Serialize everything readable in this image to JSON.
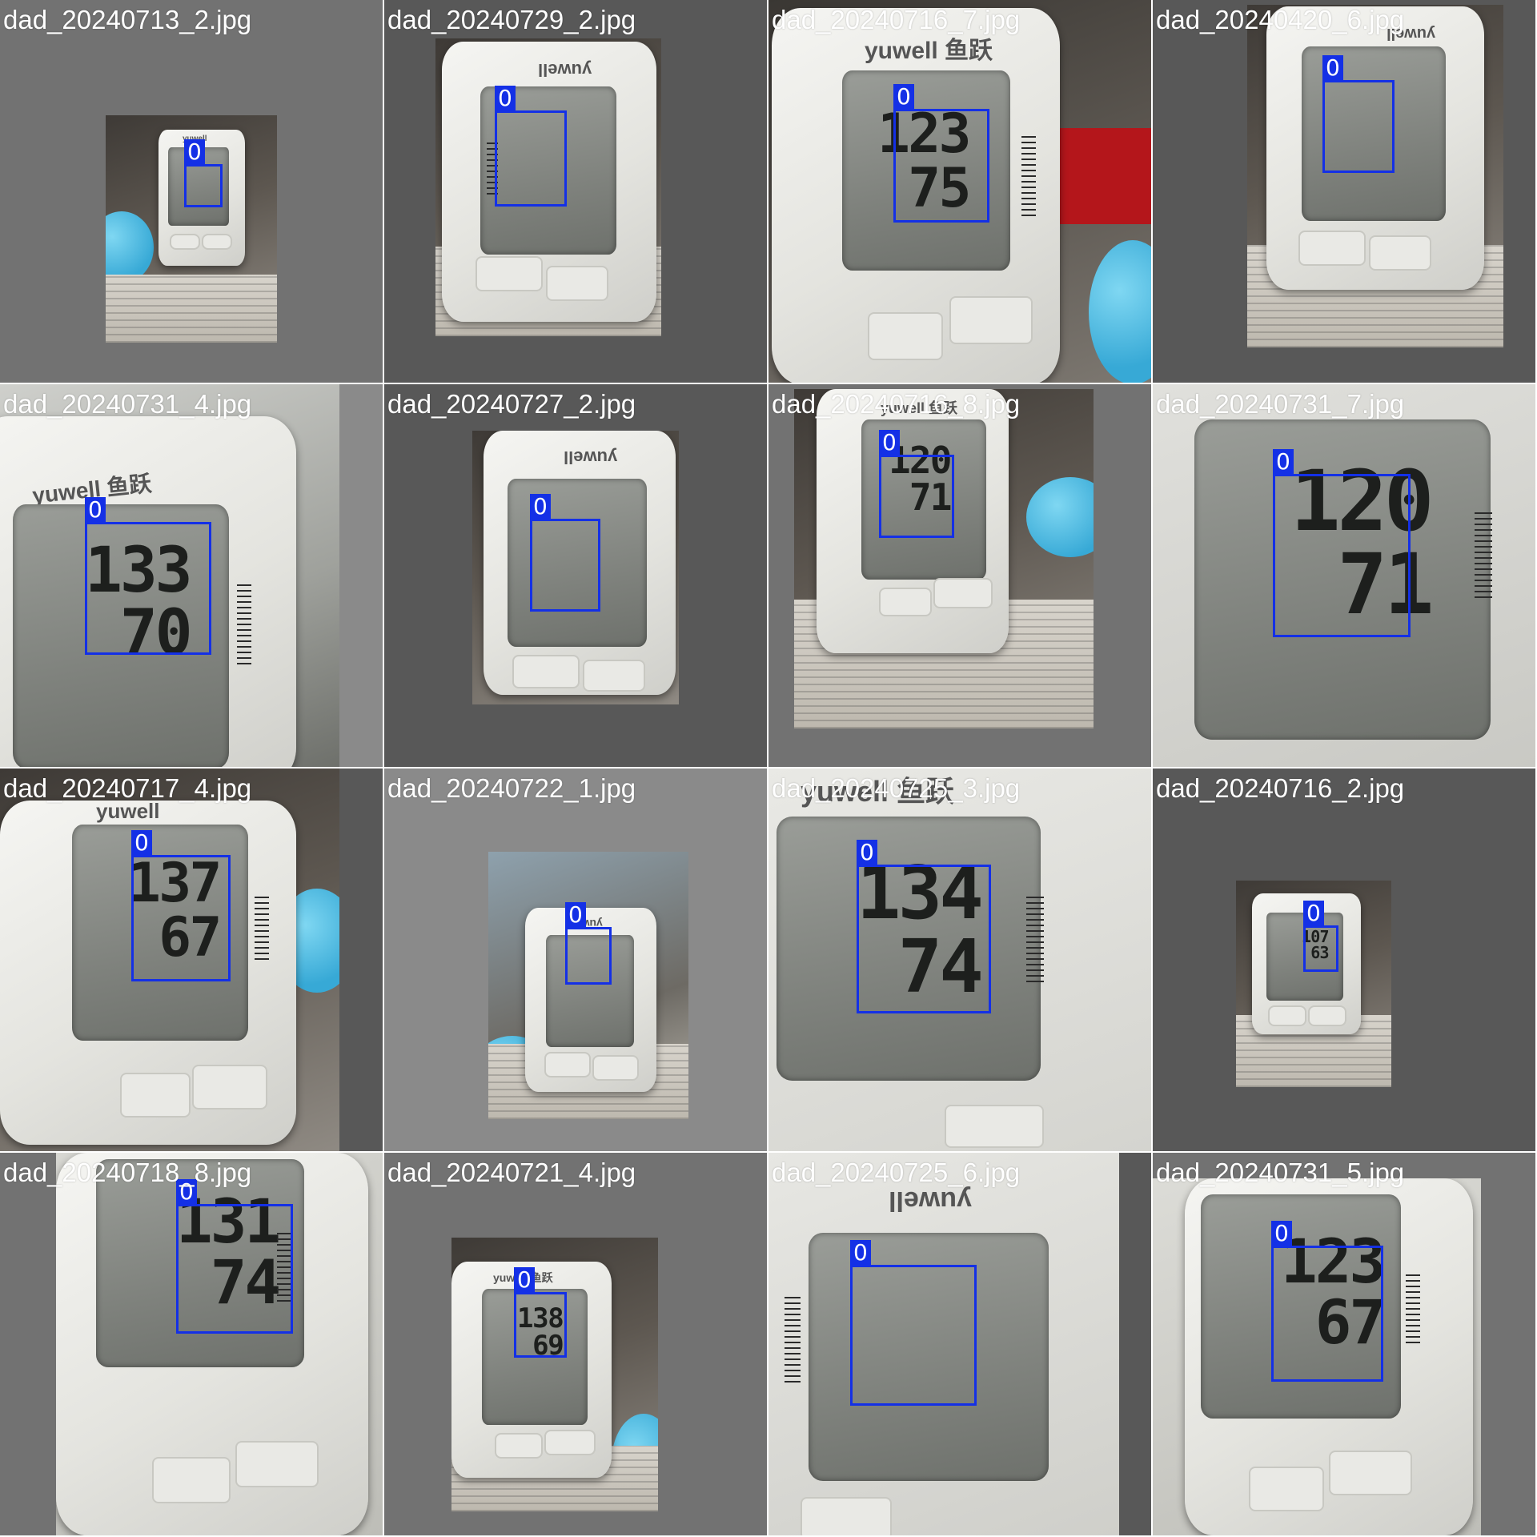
{
  "grid": {
    "tiles": [
      {
        "filename": "dad_20240713_2.jpg",
        "box_label": "0",
        "reading": {
          "systolic": "",
          "diastolic": ""
        },
        "brand": "yuwell"
      },
      {
        "filename": "dad_20240729_2.jpg",
        "box_label": "0",
        "reading": {
          "systolic": "",
          "diastolic": ""
        },
        "brand": "yuwell"
      },
      {
        "filename": "dad_20240716_7.jpg",
        "box_label": "0",
        "reading": {
          "systolic": "123",
          "diastolic": "75"
        },
        "brand": "yuwell 鱼跃"
      },
      {
        "filename": "dad_20240420_6.jpg",
        "box_label": "0",
        "reading": {
          "systolic": "",
          "diastolic": ""
        },
        "brand": "yuwell"
      },
      {
        "filename": "dad_20240731_4.jpg",
        "box_label": "0",
        "reading": {
          "systolic": "133",
          "diastolic": "70"
        },
        "brand": "yuwell 鱼跃"
      },
      {
        "filename": "dad_20240727_2.jpg",
        "box_label": "0",
        "reading": {
          "systolic": "",
          "diastolic": ""
        },
        "brand": "yuwell"
      },
      {
        "filename": "dad_20240716_8.jpg",
        "box_label": "0",
        "reading": {
          "systolic": "120",
          "diastolic": "71"
        },
        "brand": "yuwell 鱼跃"
      },
      {
        "filename": "dad_20240731_7.jpg",
        "box_label": "0",
        "reading": {
          "systolic": "120",
          "diastolic": "71"
        },
        "brand": ""
      },
      {
        "filename": "dad_20240717_4.jpg",
        "box_label": "0",
        "reading": {
          "systolic": "137",
          "diastolic": "67"
        },
        "brand": "yuwell"
      },
      {
        "filename": "dad_20240722_1.jpg",
        "box_label": "0",
        "reading": {
          "systolic": "",
          "diastolic": ""
        },
        "brand": "yuwell"
      },
      {
        "filename": "dad_20240725_3.jpg",
        "box_label": "0",
        "reading": {
          "systolic": "134",
          "diastolic": "74"
        },
        "brand": "yuwell 鱼跃"
      },
      {
        "filename": "dad_20240716_2.jpg",
        "box_label": "0",
        "reading": {
          "systolic": "107",
          "diastolic": "63"
        },
        "brand": ""
      },
      {
        "filename": "dad_20240718_8.jpg",
        "box_label": "0",
        "reading": {
          "systolic": "131",
          "diastolic": "74"
        },
        "brand": ""
      },
      {
        "filename": "dad_20240721_4.jpg",
        "box_label": "0",
        "reading": {
          "systolic": "138",
          "diastolic": "69"
        },
        "brand": "yuwell 鱼跃"
      },
      {
        "filename": "dad_20240725_6.jpg",
        "box_label": "0",
        "reading": {
          "systolic": "",
          "diastolic": ""
        },
        "brand": "yuwell"
      },
      {
        "filename": "dad_20240731_5.jpg",
        "box_label": "0",
        "reading": {
          "systolic": "123",
          "diastolic": "67"
        },
        "brand": ""
      }
    ]
  },
  "colors": {
    "box": "#1430e6",
    "caption": "#ffffff",
    "tile_background": "#727272"
  }
}
